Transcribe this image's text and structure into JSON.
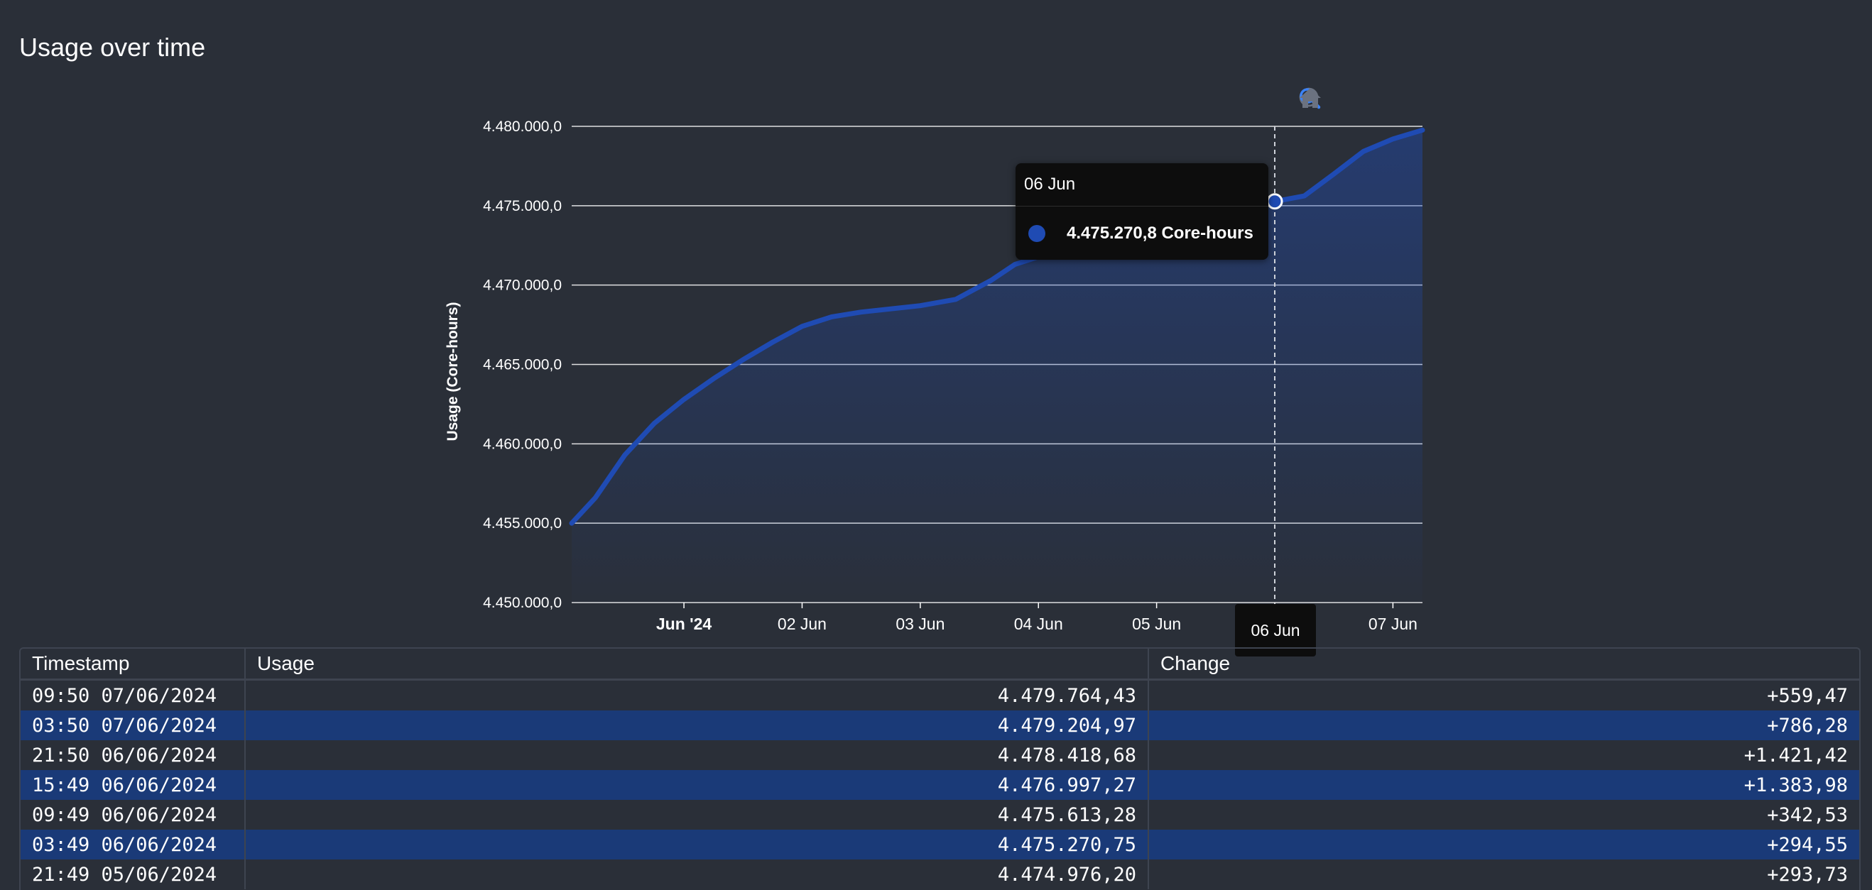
{
  "page": {
    "title": "Usage over time"
  },
  "toolbar": {
    "icons": [
      "zoom-in-icon",
      "zoom-out-icon",
      "selection-zoom-icon",
      "home-icon"
    ],
    "active_icon": "selection-zoom-icon"
  },
  "colors": {
    "background": "#2a2f38",
    "series": "#1f4bb3",
    "grid": "#ffffff",
    "row_highlight": "#1a3a78"
  },
  "chart_data": {
    "type": "area",
    "ylabel": "Usage (Core-hours)",
    "ylim": [
      4450000,
      4480000
    ],
    "ytick_labels": [
      "4.450.000,0",
      "4.455.000,0",
      "4.460.000,0",
      "4.465.000,0",
      "4.470.000,0",
      "4.475.000,0",
      "4.480.000,0"
    ],
    "yticks": [
      4450000,
      4455000,
      4460000,
      4465000,
      4470000,
      4475000,
      4480000
    ],
    "xlim": [
      -0.95,
      6.25
    ],
    "xticks": [
      0,
      1,
      2,
      3,
      4,
      5,
      6
    ],
    "xtick_labels": [
      "Jun '24",
      "02 Jun",
      "03 Jun",
      "04 Jun",
      "05 Jun",
      "06 Jun",
      "07 Jun"
    ],
    "grid": true,
    "series": [
      {
        "values": [
          [
            -0.95,
            4455000
          ],
          [
            -0.75,
            4456600
          ],
          [
            -0.5,
            4459300
          ],
          [
            -0.25,
            4461300
          ],
          [
            0.0,
            4462800
          ],
          [
            0.25,
            4464100
          ],
          [
            0.5,
            4465300
          ],
          [
            0.75,
            4466400
          ],
          [
            1.0,
            4467400
          ],
          [
            1.25,
            4468000
          ],
          [
            1.5,
            4468300
          ],
          [
            1.75,
            4468500
          ],
          [
            2.0,
            4468700
          ],
          [
            2.3,
            4469100
          ],
          [
            2.6,
            4470300
          ],
          [
            2.8,
            4471300
          ],
          [
            3.05,
            4471900
          ],
          [
            3.3,
            4472500
          ],
          [
            3.6,
            4473300
          ],
          [
            3.9,
            4473900
          ],
          [
            4.2,
            4474500
          ],
          [
            4.55,
            4474976.2
          ],
          [
            4.8,
            4475100
          ],
          [
            5.0,
            4475270.8
          ],
          [
            5.25,
            4475613.3
          ],
          [
            5.5,
            4476997.3
          ],
          [
            5.75,
            4478418.7
          ],
          [
            6.0,
            4479205.0
          ],
          [
            6.25,
            4479764.4
          ]
        ]
      }
    ],
    "hover": {
      "x_label": "06 Jun",
      "value_label": "4.475.270,8 Core-hours",
      "x": 5.0,
      "y": 4475270.8
    }
  },
  "table": {
    "columns": [
      "Timestamp",
      "Usage",
      "Change"
    ],
    "rows": [
      [
        "09:50 07/06/2024",
        "4.479.764,43",
        "+559,47"
      ],
      [
        "03:50 07/06/2024",
        "4.479.204,97",
        "+786,28"
      ],
      [
        "21:50 06/06/2024",
        "4.478.418,68",
        "+1.421,42"
      ],
      [
        "15:49 06/06/2024",
        "4.476.997,27",
        "+1.383,98"
      ],
      [
        "09:49 06/06/2024",
        "4.475.613,28",
        "+342,53"
      ],
      [
        "03:49 06/06/2024",
        "4.475.270,75",
        "+294,55"
      ],
      [
        "21:49 05/06/2024",
        "4.474.976,20",
        "+293,73"
      ]
    ]
  }
}
